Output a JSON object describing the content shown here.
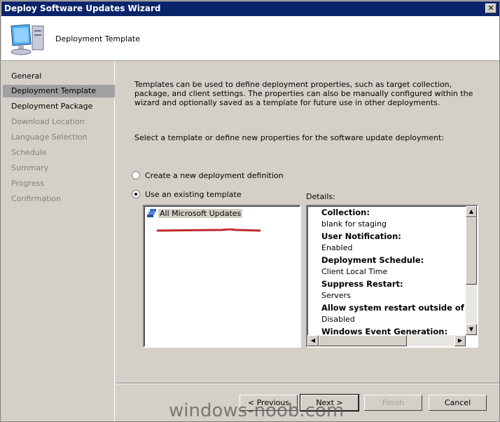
{
  "window": {
    "title": "Deploy Software Updates Wizard",
    "close_label": "✕"
  },
  "header": {
    "title": "Deployment Template",
    "icon": "computer-icon"
  },
  "sidebar": {
    "items": [
      {
        "label": "General",
        "state": "normal"
      },
      {
        "label": "Deployment Template",
        "state": "selected"
      },
      {
        "label": "Deployment Package",
        "state": "normal"
      },
      {
        "label": "Download Location",
        "state": "disabled"
      },
      {
        "label": "Language Selection",
        "state": "disabled"
      },
      {
        "label": "Schedule",
        "state": "disabled"
      },
      {
        "label": "Summary",
        "state": "disabled"
      },
      {
        "label": "Progress",
        "state": "disabled"
      },
      {
        "label": "Confirmation",
        "state": "disabled"
      }
    ]
  },
  "main": {
    "description": "Templates can be used to define deployment properties, such as target collection, package, and client settings. The properties can also be manually configured within the wizard and optionally saved as a template for future use in other deployments.",
    "prompt": "Select a template or define new properties for the software update deployment:",
    "radio_new": {
      "label": "Create a new deployment definition",
      "checked": false
    },
    "radio_existing": {
      "label": "Use an existing template",
      "checked": true
    },
    "templates": [
      {
        "label": "All Microsoft Updates",
        "icon": "update-template-icon"
      }
    ],
    "details_label": "Details:",
    "details": [
      {
        "text": "Collection:",
        "bold": true
      },
      {
        "text": "blank for staging",
        "bold": false
      },
      {
        "text": "User Notification:",
        "bold": true
      },
      {
        "text": "Enabled",
        "bold": false
      },
      {
        "text": "Deployment Schedule:",
        "bold": true
      },
      {
        "text": "Client Local Time",
        "bold": false
      },
      {
        "text": "Suppress Restart:",
        "bold": true
      },
      {
        "text": "Servers",
        "bold": false
      },
      {
        "text": "Allow system restart outside of maint",
        "bold": true
      },
      {
        "text": "Disabled",
        "bold": false
      },
      {
        "text": "Windows Event Generation:",
        "bold": true
      }
    ]
  },
  "buttons": {
    "previous": "< Previous",
    "next": "Next >",
    "finish": "Finish",
    "cancel": "Cancel"
  },
  "watermark": "windows-noob.com",
  "colors": {
    "titlebar": "#0a246a",
    "face": "#d4d0c8",
    "selected": "#a0a0a0",
    "redline": "#c0282d"
  }
}
